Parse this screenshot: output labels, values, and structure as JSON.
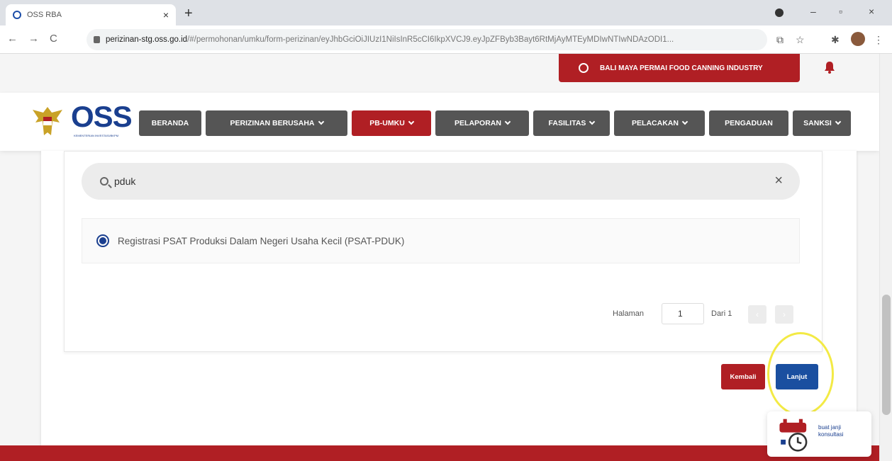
{
  "browser": {
    "tab_title": "OSS RBA",
    "tab_close": "×",
    "new_tab": "+",
    "url_host": "perizinan-stg.oss.go.id",
    "url_path": "/#/permohonan/umku/form-perizinan/eyJhbGciOiJIUzI1NiIsInR5cCI6IkpXVCJ9.eyJpZFByb3Bayt6RtMjAyMTEyMDIwNTIwNDAzODI1..."
  },
  "header": {
    "company_name": "BALI MAYA PERMAI FOOD CANNING INDUSTRY"
  },
  "logo": {
    "text": "OSS",
    "subtext": "KEMENTERIAN INVESTASI/BKPM"
  },
  "nav": {
    "items": [
      {
        "label": "BERANDA"
      },
      {
        "label": "PERIZINAN BERUSAHA"
      },
      {
        "label": "PB-UMKU"
      },
      {
        "label": "PELAPORAN"
      },
      {
        "label": "FASILITAS"
      },
      {
        "label": "PELACAKAN"
      },
      {
        "label": "PENGADUAN"
      },
      {
        "label": "SANKSI"
      }
    ]
  },
  "search": {
    "value": "pduk",
    "clear": "×"
  },
  "results": [
    {
      "label": "Registrasi PSAT Produksi Dalam Negeri Usaha Kecil (PSAT-PDUK)",
      "selected": true
    }
  ],
  "pagination": {
    "label": "Halaman",
    "current": "1",
    "of": "Dari 1",
    "prev": "‹",
    "next": "›"
  },
  "actions": {
    "back": "Kembali",
    "next": "Lanjut"
  },
  "consult": {
    "line1": "buat janji",
    "line2": "konsultasi"
  },
  "colors": {
    "brand_red": "#b01f24",
    "brand_blue": "#1a4fa0",
    "nav_gray": "#555555",
    "highlight_yellow": "#f3ea45"
  }
}
